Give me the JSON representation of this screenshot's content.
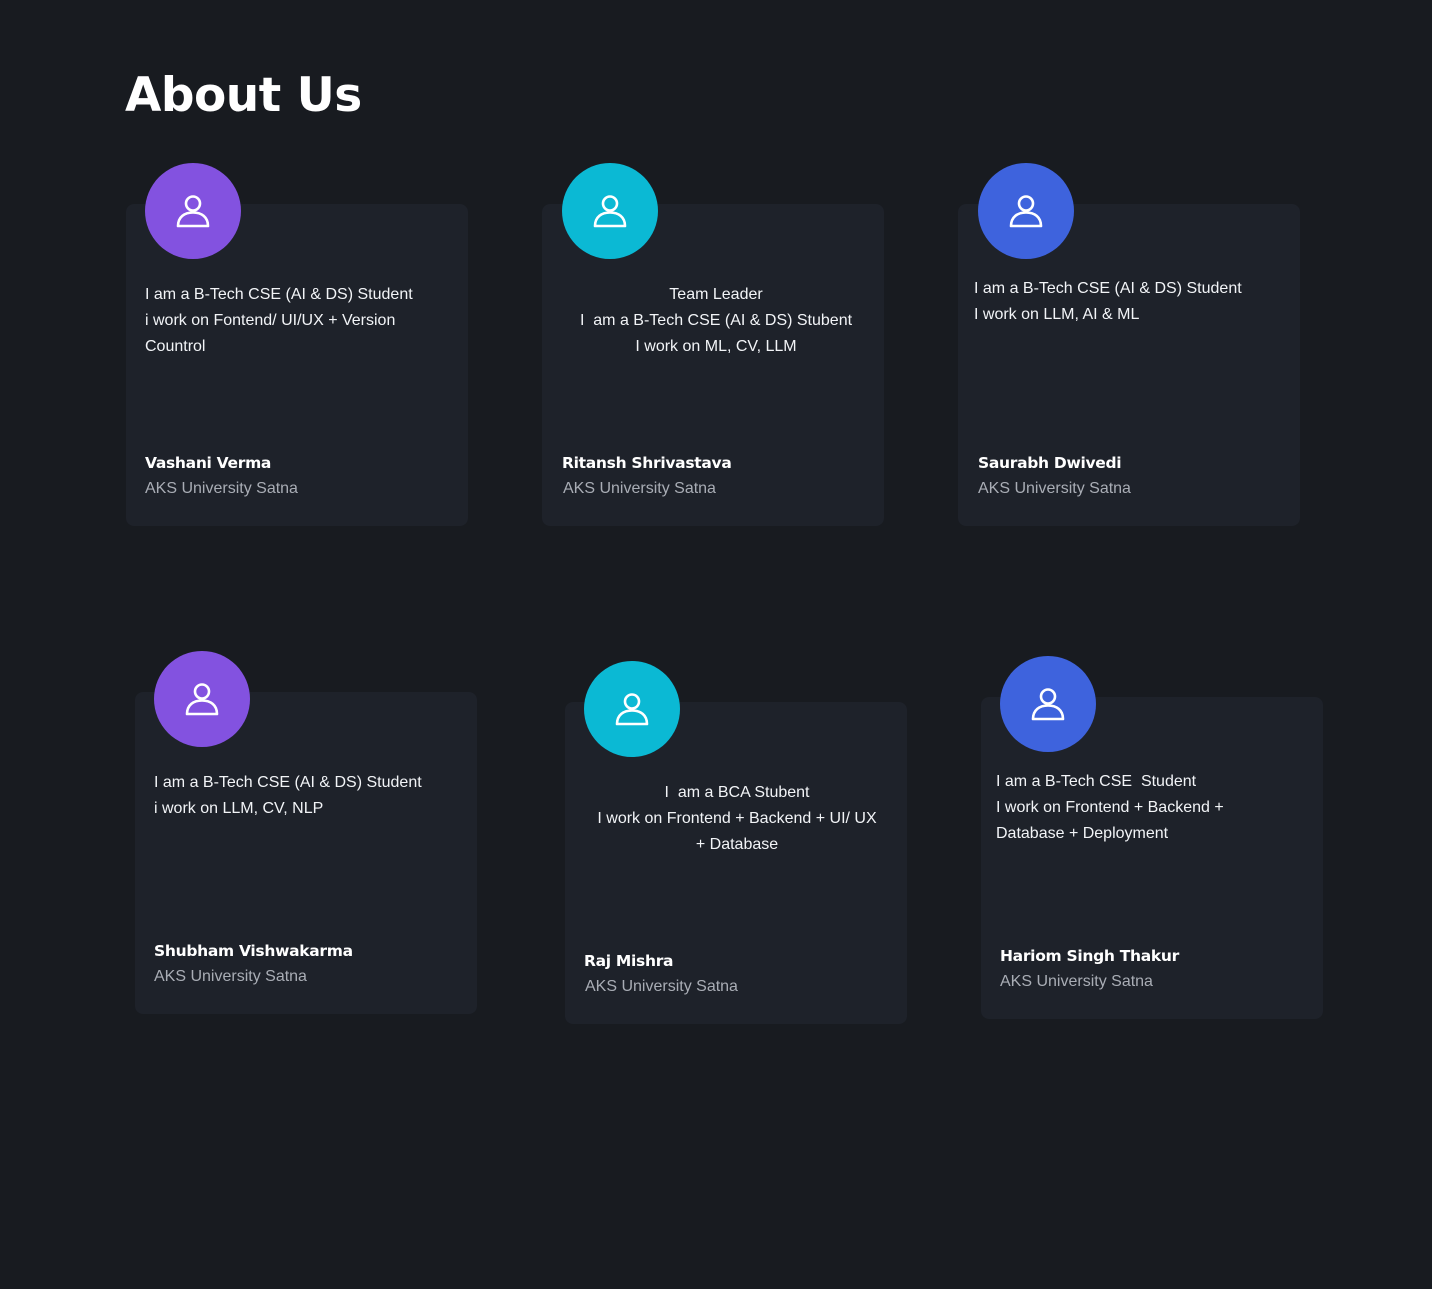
{
  "page": {
    "title": "About Us"
  },
  "colors": {
    "background": "#181b20",
    "card": "#1e222a",
    "purple": "#8352e0",
    "cyan": "#0bb9d4",
    "blue": "#3e63dd",
    "muted_text": "#a9adb5"
  },
  "members": [
    {
      "avatar_icon": "user-icon",
      "avatar_color": "#8352e0",
      "bio": "I am a B-Tech CSE (AI & DS) Student\ni work on Fontend/ UI/UX + Version\nCountrol",
      "name": "Vashani Verma",
      "org": "AKS University Satna"
    },
    {
      "avatar_icon": "user-icon",
      "avatar_color": "#0bb9d4",
      "bio": "Team Leader\nI  am a B-Tech CSE (AI & DS) Stubent\nI work on ML, CV, LLM",
      "name": "Ritansh Shrivastava",
      "org": "AKS University Satna"
    },
    {
      "avatar_icon": "user-icon",
      "avatar_color": "#3e63dd",
      "bio": "I am a B-Tech CSE (AI & DS) Student\nI work on LLM, AI & ML",
      "name": "Saurabh Dwivedi",
      "org": "AKS University Satna"
    },
    {
      "avatar_icon": "user-icon",
      "avatar_color": "#8352e0",
      "bio": "I am a B-Tech CSE (AI & DS) Student\ni work on LLM, CV, NLP",
      "name": "Shubham Vishwakarma",
      "org": "AKS University Satna"
    },
    {
      "avatar_icon": "user-icon",
      "avatar_color": "#0bb9d4",
      "bio": "I  am a BCA Stubent\nI work on Frontend + Backend + UI/ UX\n+ Database",
      "name": "Raj Mishra",
      "org": "AKS University Satna"
    },
    {
      "avatar_icon": "user-icon",
      "avatar_color": "#3e63dd",
      "bio": "I am a B-Tech CSE  Student\nI work on Frontend + Backend +\nDatabase + Deployment",
      "name": "Hariom Singh Thakur",
      "org": "AKS University Satna"
    }
  ]
}
